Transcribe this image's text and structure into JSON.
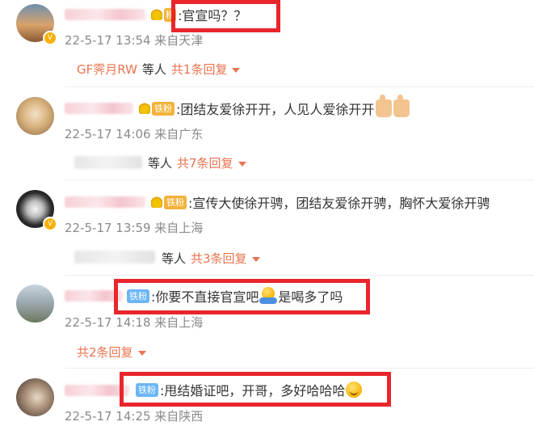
{
  "colors": {
    "accent": "#eb7350",
    "meta_gray": "#8a8a8a",
    "highlight_red": "#e8262b",
    "fan_orange": "#f3b23a",
    "fan_blue": "#6bb6f5"
  },
  "comments": [
    {
      "text": ":官宣吗？？",
      "badge": "",
      "time": "22-5-17 13:54 来自天津",
      "reply": {
        "name": "GF霁月RW",
        "others": "等人",
        "count": "共1条回复"
      }
    },
    {
      "text": ":团结友爱徐开开，人见人爱徐开开",
      "badge": "铁粉",
      "time": "22-5-17 14:06 来自广东",
      "reply": {
        "name": "",
        "others": "等人",
        "count": "共7条回复"
      }
    },
    {
      "text": ":宣传大使徐开骋，团结友爱徐开骋，胸怀大爱徐开骋",
      "badge": "铁粉",
      "time": "22-5-17 13:59 来自上海",
      "reply": {
        "name": "",
        "others": "等人",
        "count": "共3条回复"
      }
    },
    {
      "text_a": ":你要不直接官宣吧",
      "text_b": "是喝多了吗",
      "badge": "铁粉",
      "time": "22-5-17 14:18 来自上海",
      "reply": {
        "count": "共2条回复"
      }
    },
    {
      "text": ":甩结婚证吧，开哥，多好哈哈哈",
      "badge": "铁粉",
      "time": "22-5-17 14:25 来自陕西"
    }
  ],
  "icons": {
    "avatar_badge": "vip-crown-icon",
    "caret": "chevron-down-icon",
    "fan": "fan-crown-icon"
  }
}
